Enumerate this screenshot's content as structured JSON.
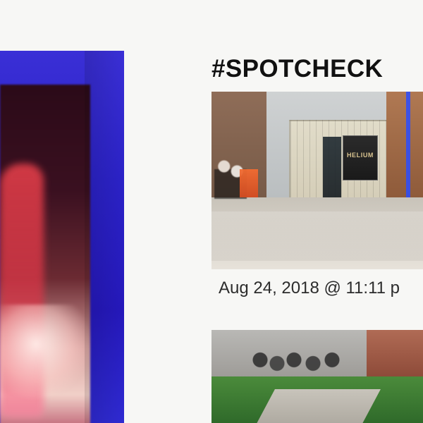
{
  "post": {
    "title": "#SPOTCHECK",
    "timestamp": "Aug 24, 2018 @ 11:11 p",
    "photos": [
      {
        "sign_text": "HELIUM"
      },
      {}
    ]
  },
  "media": {
    "left_panel_colors": {
      "primary": "#2b22c7",
      "accent": "#ff4050"
    }
  }
}
